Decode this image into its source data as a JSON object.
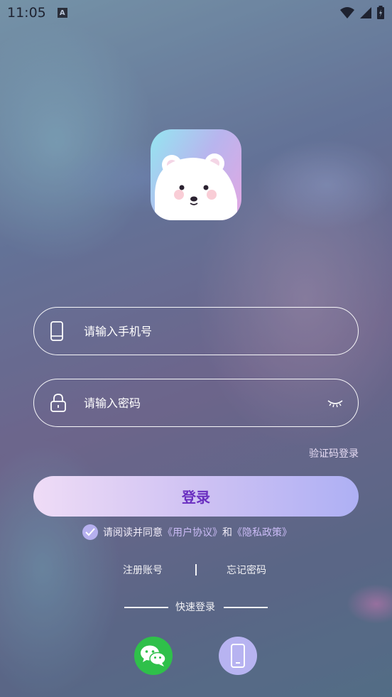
{
  "status_bar": {
    "time": "11:05",
    "notification_badge": "A"
  },
  "login_form": {
    "phone_placeholder": "请输入手机号",
    "phone_value": "",
    "password_placeholder": "请输入密码",
    "password_value": "",
    "code_login_label": "验证码登录",
    "login_button_label": "登录"
  },
  "agreement": {
    "checked": true,
    "prefix": "请阅读并同意",
    "user_agreement": "《用户协议》",
    "conjunction": "和",
    "privacy_policy": "《隐私政策》"
  },
  "links": {
    "register": "注册账号",
    "forgot_password": "忘记密码"
  },
  "quick_login": {
    "label": "快速登录",
    "methods": [
      "wechat-icon",
      "phone-icon"
    ]
  },
  "colors": {
    "login_text": "#6a2fc0",
    "wechat_green": "#2fc04a",
    "phone_button": "#b7b3f1",
    "link_lavender": "#cbbcf6"
  }
}
